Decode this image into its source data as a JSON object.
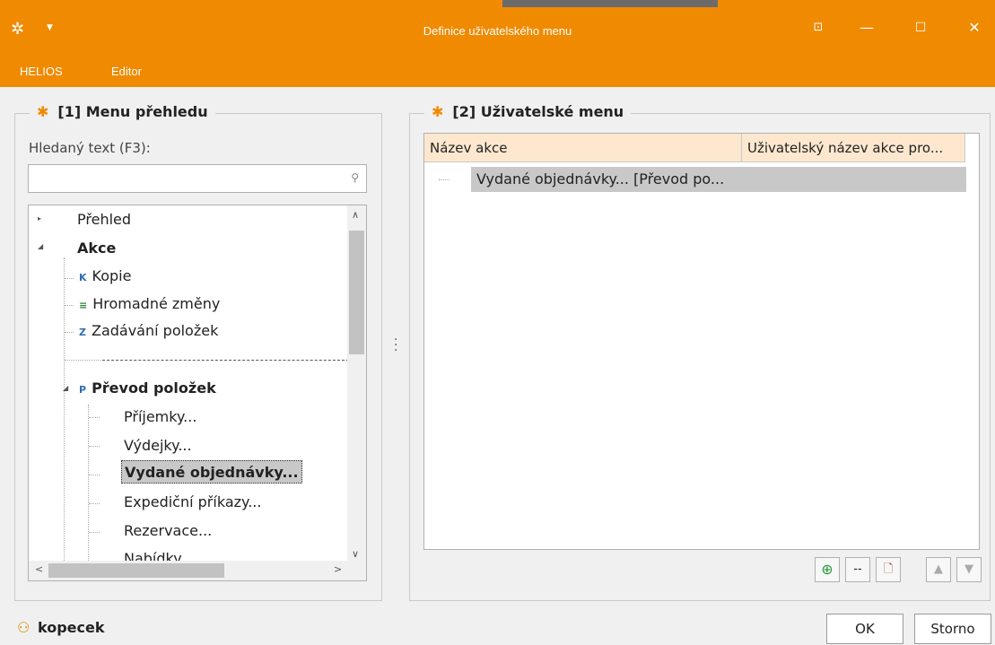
{
  "window": {
    "title": "Definice uživatelského menu",
    "buttons": {
      "pin": "⊡",
      "minimize": "—",
      "maximize": "☐",
      "close": "✕"
    }
  },
  "menubar": {
    "items": [
      "HELIOS",
      "Editor"
    ]
  },
  "left_panel": {
    "title": "[1] Menu přehledu",
    "search_label": "Hledaný text (F3):",
    "search_value": "",
    "tree": {
      "prehled": "Přehled",
      "akce": "Akce",
      "kopie": {
        "icon": "K",
        "label": "Kopie"
      },
      "hromadne": {
        "icon": "≡",
        "label": "Hromadné změny"
      },
      "zadavani": {
        "icon": "Z",
        "label": "Zadávání položek"
      },
      "prevod": {
        "icon": "P",
        "label": "Převod položek"
      },
      "children": [
        "Příjemky...",
        "Výdejky...",
        "Vydané objednávky...",
        "Expediční příkazy...",
        "Rezervace...",
        "Nabídky..."
      ],
      "selected_index": 2
    }
  },
  "right_panel": {
    "title": "[2] Uživatelské menu",
    "columns": [
      "Název akce",
      "Uživatelský název akce pro..."
    ],
    "rows": [
      "Vydané objednávky... [Převod po..."
    ],
    "toolbar": [
      "add-icon",
      "separator-icon",
      "delete-icon",
      "move-up-icon",
      "move-down-icon"
    ]
  },
  "footer": {
    "user": "kopecek",
    "ok_label": "OK",
    "cancel_label": "Storno"
  },
  "colors": {
    "accent": "#f08a00",
    "header_bg": "#fde8cf",
    "selection": "#c8c8c8"
  }
}
